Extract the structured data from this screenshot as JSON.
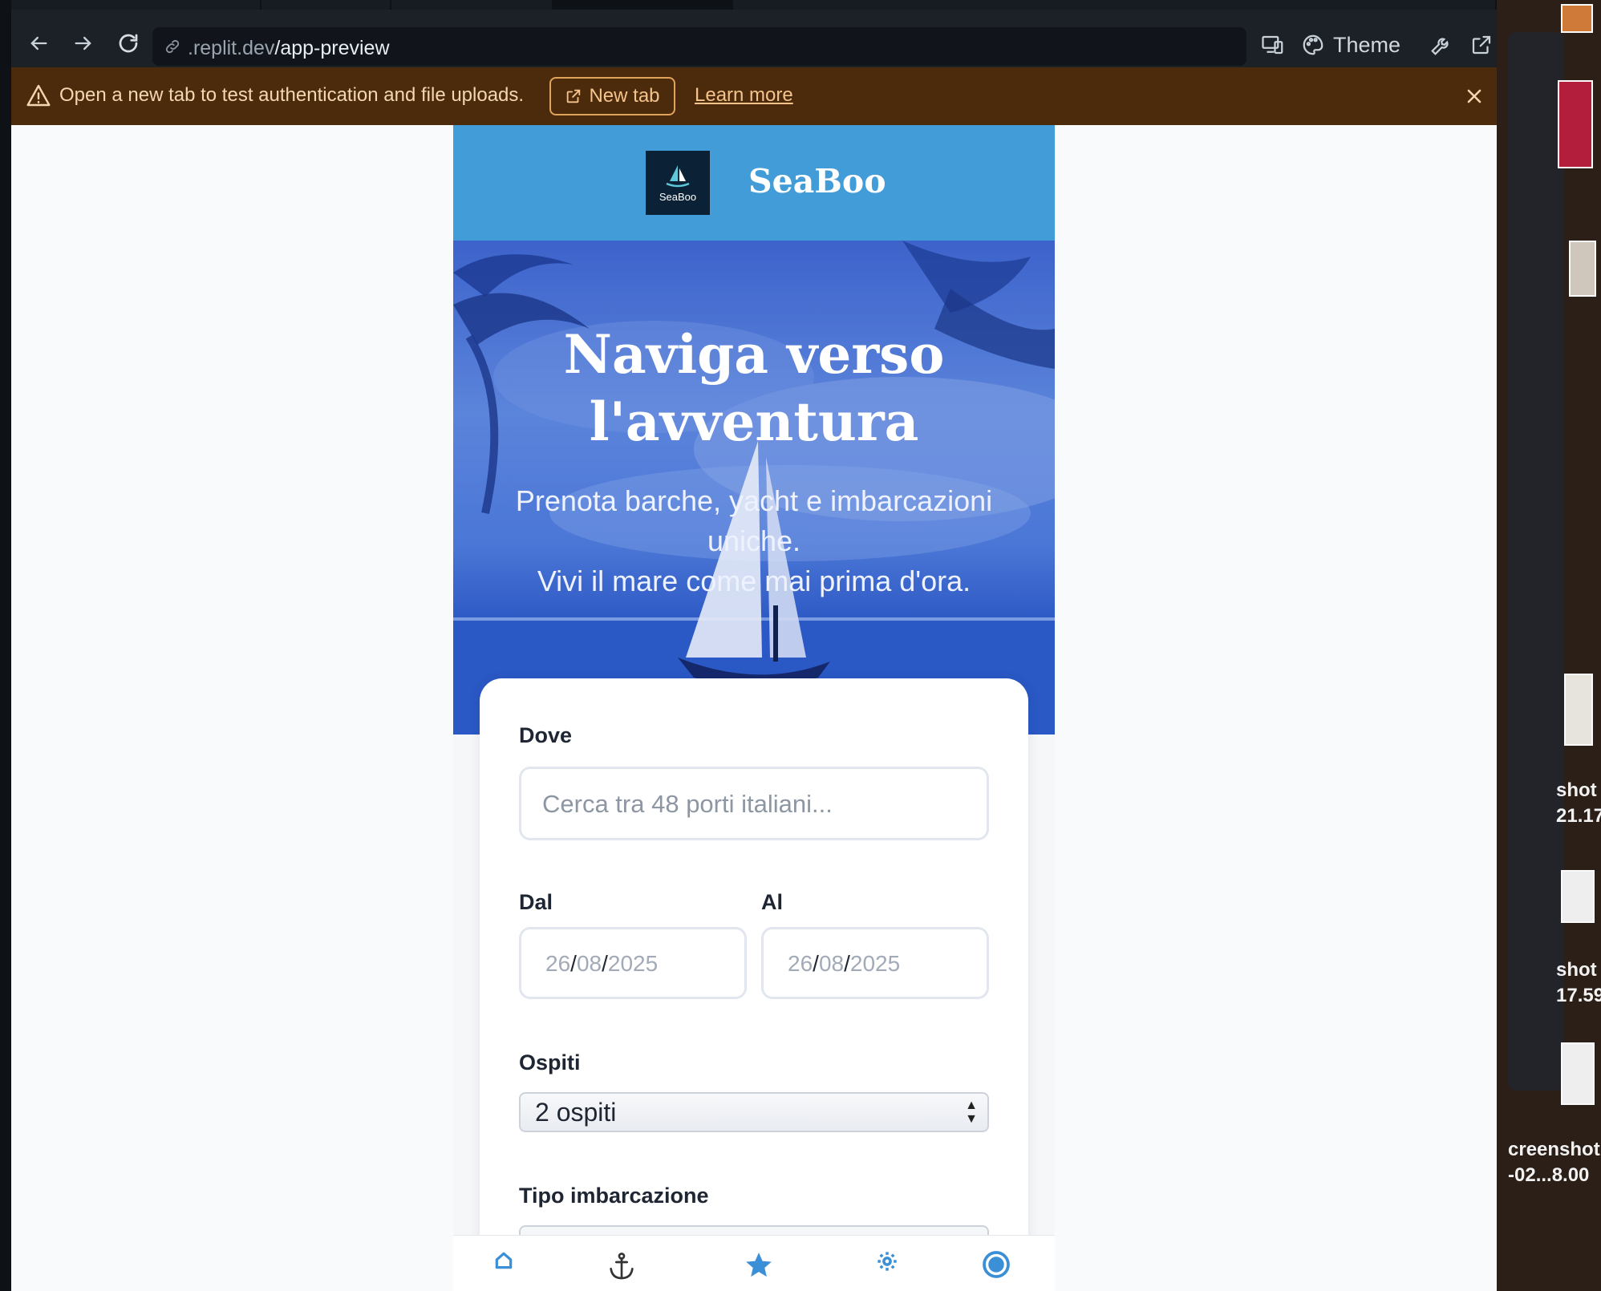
{
  "browser": {
    "url_prefix": ".replit.dev",
    "url_path": "/app-preview",
    "theme_label": "Theme",
    "icons": [
      "back-arrow-icon",
      "forward-arrow-icon",
      "reload-icon",
      "link-icon",
      "devices-icon",
      "palette-icon",
      "wrench-icon",
      "external-link-icon"
    ]
  },
  "banner": {
    "message": "Open a new tab to test authentication and file uploads.",
    "new_tab_label": "New tab",
    "learn_more_label": "Learn more",
    "colors": {
      "background": "#4c2a0c",
      "accent": "#f4c48c"
    }
  },
  "app": {
    "brand": "SeaBoo",
    "logo_text": "SeaBoo",
    "hero": {
      "title_line1": "Naviga verso",
      "title_line2": "l'avventura",
      "subtitle_line1": "Prenota barche, yacht e imbarcazioni uniche.",
      "subtitle_line2": "Vivi il mare come mai prima d'ora."
    },
    "search": {
      "where_label": "Dove",
      "where_placeholder": "Cerca tra 48 porti italiani...",
      "from_label": "Dal",
      "to_label": "Al",
      "from_date": {
        "day": "26",
        "month": "08",
        "year": "2025"
      },
      "to_date": {
        "day": "26",
        "month": "08",
        "year": "2025"
      },
      "guests_label": "Ospiti",
      "guests_value": "2 ospiti",
      "boat_type_label": "Tipo imbarcazione"
    },
    "bottom_nav": [
      "home-icon",
      "anchor-icon",
      "star-icon",
      "gear-icon",
      "profile-icon"
    ],
    "colors": {
      "header": "#429cd8",
      "accent": "#3b8fd6"
    }
  },
  "desktop": {
    "labels": [
      {
        "line1": "shot",
        "line2": "21.17"
      },
      {
        "line1": "shot",
        "line2": "17.59"
      },
      {
        "line1": "creenshot",
        "line2": "-02...8.00"
      }
    ]
  }
}
